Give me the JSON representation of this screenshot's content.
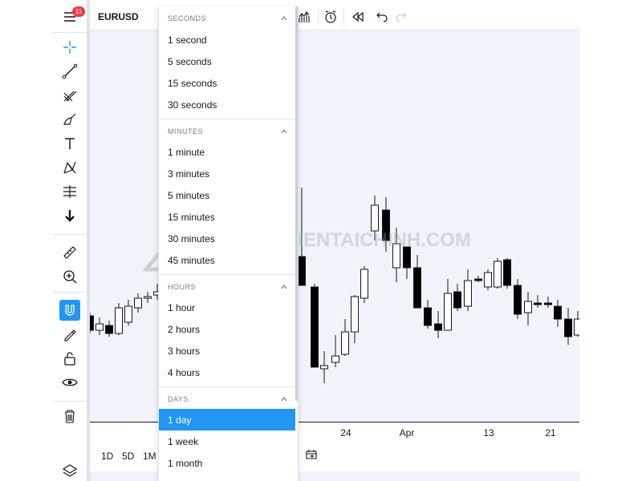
{
  "toolbar": {
    "notification_count": "11",
    "icons": [
      "menu-icon",
      "crosshair-icon",
      "trend-line-icon",
      "pitchfork-icon",
      "brush-icon",
      "text-icon",
      "pattern-icon",
      "long-position-icon",
      "arrow-down-icon",
      "ruler-icon",
      "zoom-in-icon",
      "magnet-icon",
      "lock-drawing-icon",
      "unlock-icon",
      "eye-icon",
      "trash-icon",
      "layers-icon"
    ],
    "active_icon": "magnet-icon",
    "accent_color": "#2196f3"
  },
  "topbar": {
    "symbol": "EURUSD",
    "buttons": [
      "indicators-icon",
      "alert-icon",
      "replay-icon",
      "undo-icon",
      "redo-icon"
    ]
  },
  "chart": {
    "background": "#f0f3fa",
    "x_ticks": [
      "24",
      "Apr",
      "13",
      "21"
    ]
  },
  "watermark": {
    "text": "THUVIENTAICHINH.COM"
  },
  "bottombar": {
    "ranges": [
      "1D",
      "5D",
      "1M"
    ],
    "icon": "goto-date-icon"
  },
  "dropdown": {
    "sections": [
      {
        "title": "SECONDS",
        "items": [
          "1 second",
          "5 seconds",
          "15 seconds",
          "30 seconds"
        ]
      },
      {
        "title": "MINUTES",
        "items": [
          "1 minute",
          "3 minutes",
          "5 minutes",
          "15 minutes",
          "30 minutes",
          "45 minutes"
        ]
      },
      {
        "title": "HOURS",
        "items": [
          "1 hour",
          "2 hours",
          "3 hours",
          "4 hours"
        ]
      },
      {
        "title": "DAYS",
        "items": [
          "1 day",
          "1 week",
          "1 month"
        ]
      }
    ],
    "selected": "1 day",
    "selected_color": "#2196f3"
  }
}
